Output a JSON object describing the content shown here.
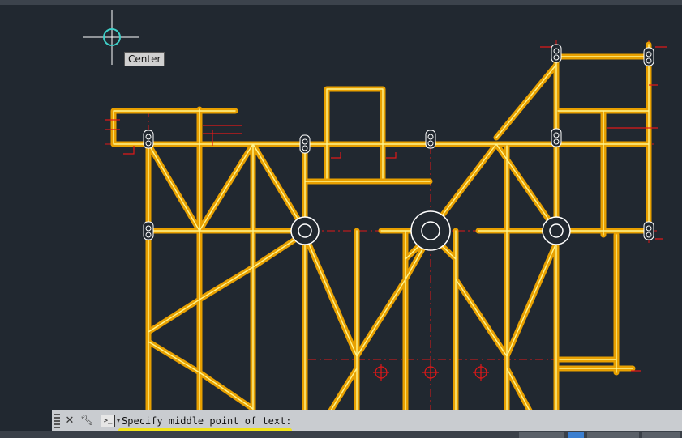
{
  "tooltip": {
    "label": "Center"
  },
  "command_line": {
    "prompt": "Specify middle point of text:",
    "close_icon": "close-icon",
    "customize_icon": "wrench-icon",
    "prompt_icon": "command-prompt-icon",
    "highlight_color": "#f0e21a"
  },
  "colors": {
    "background": "#212830",
    "structure_outer": "#e8a000",
    "structure_inner": "#fff48c",
    "centerline": "#e01818",
    "cursor": "#ffffff",
    "snap_marker": "#3fd0c8"
  }
}
